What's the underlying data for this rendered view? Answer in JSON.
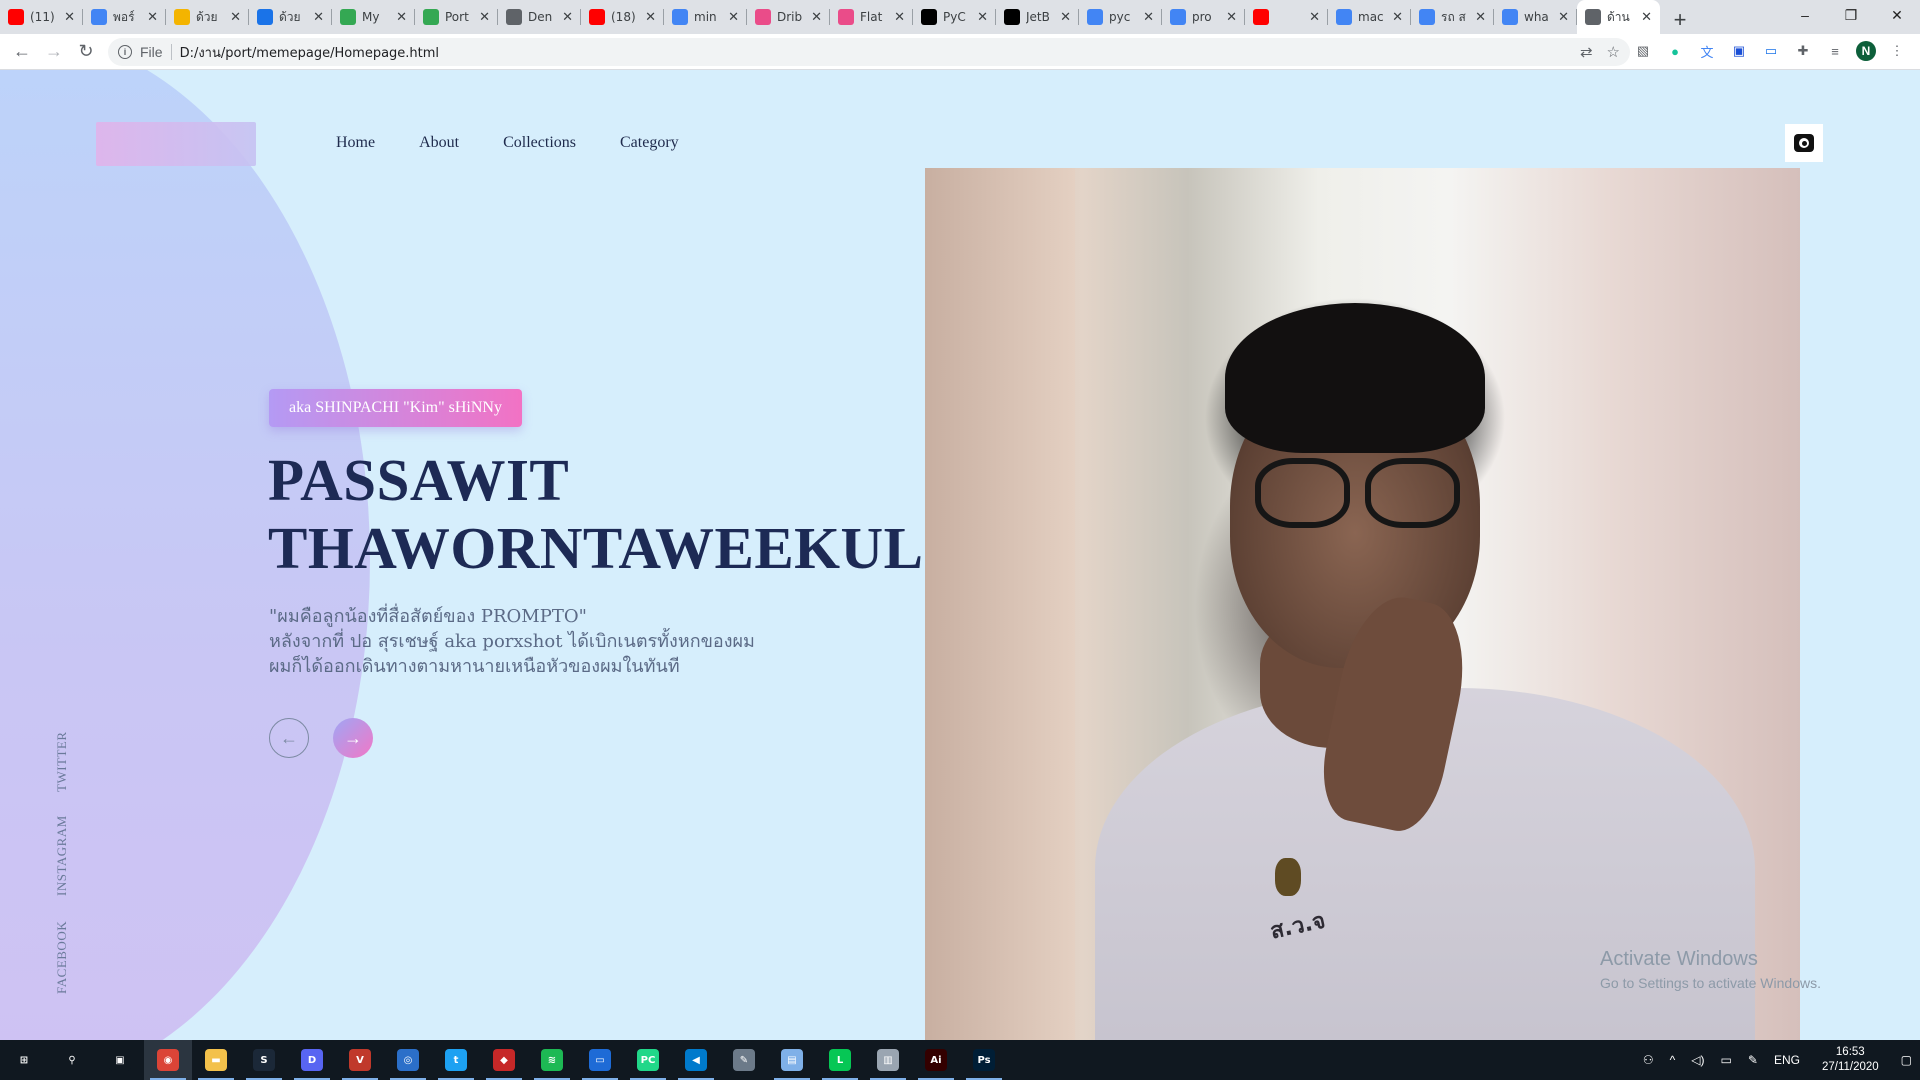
{
  "browser": {
    "tabs": [
      {
        "label": "(11)",
        "icon": "youtube-icon",
        "color": "#ff0000"
      },
      {
        "label": "พอร์",
        "icon": "google-icon",
        "color": "#4285f4"
      },
      {
        "label": "ด้วย",
        "icon": "slides-icon",
        "color": "#f4b400"
      },
      {
        "label": "ด้วย",
        "icon": "meet-icon",
        "color": "#1a73e8"
      },
      {
        "label": "My",
        "icon": "drive-icon",
        "color": "#34a853"
      },
      {
        "label": "Port",
        "icon": "drive-icon",
        "color": "#34a853"
      },
      {
        "label": "Den",
        "icon": "globe-icon",
        "color": "#5f6368"
      },
      {
        "label": "(18)",
        "icon": "youtube-icon",
        "color": "#ff0000"
      },
      {
        "label": "min",
        "icon": "google-icon",
        "color": "#4285f4"
      },
      {
        "label": "Drib",
        "icon": "dribbble-icon",
        "color": "#ea4c89"
      },
      {
        "label": "Flat",
        "icon": "dribbble-icon",
        "color": "#ea4c89"
      },
      {
        "label": "PyC",
        "icon": "jetbrains-icon",
        "color": "#000000"
      },
      {
        "label": "JetB",
        "icon": "jetbrains-icon",
        "color": "#000000"
      },
      {
        "label": "pyc",
        "icon": "google-icon",
        "color": "#4285f4"
      },
      {
        "label": "pro",
        "icon": "google-icon",
        "color": "#4285f4"
      },
      {
        "label": "",
        "icon": "youtube-icon",
        "color": "#ff0000"
      },
      {
        "label": "mac",
        "icon": "google-icon",
        "color": "#4285f4"
      },
      {
        "label": "รถ ส",
        "icon": "google-icon",
        "color": "#4285f4"
      },
      {
        "label": "wha",
        "icon": "google-icon",
        "color": "#4285f4"
      },
      {
        "label": "ด้าน",
        "icon": "globe-icon",
        "color": "#5f6368"
      }
    ],
    "address": {
      "scheme": "File",
      "url": "D:/งาน/port/memepage/Homepage.html"
    },
    "profile_initial": "N"
  },
  "site": {
    "nav": [
      "Home",
      "About",
      "Collections",
      "Category"
    ],
    "badge": "aka SHINPACHI \"Kim\" sHiNNy",
    "headline_line1": "PASSAWIT",
    "headline_line2": "THAWORNTAWEEKUL",
    "desc_line1": "\"ผมคือลูกน้องที่สื่อสัตย์ของ PROMPTO\"",
    "desc_line2": "หลังจากที่ ปอ สุรเชษฐ์ aka porxshot ได้เบิกเนตรทั้งหกของผม",
    "desc_line3": "ผมก็ได้ออกเดินทางตามหานายเหนือหัวของผมในทันที",
    "prev_arrow": "←",
    "next_arrow": "→",
    "social": [
      "TWITTER",
      "INSTAGRAM",
      "FACEBOOK"
    ],
    "photo_patch_text": "ส.ว.จ",
    "colors": {
      "background": "#d6eefc",
      "headline": "#1d2a55",
      "badge_gradient_start": "#b49af4",
      "badge_gradient_end": "#f272c4"
    }
  },
  "watermark": {
    "title": "Activate Windows",
    "subtitle": "Go to Settings to activate Windows."
  },
  "taskbar": {
    "apps": [
      {
        "name": "start-icon",
        "glyph": "⊞",
        "color": "#101820"
      },
      {
        "name": "search-icon",
        "glyph": "⚲",
        "color": "#101820"
      },
      {
        "name": "task-view-icon",
        "glyph": "▣",
        "color": "#101820"
      },
      {
        "name": "chrome-icon",
        "glyph": "◉",
        "color": "#db4437"
      },
      {
        "name": "file-explorer-icon",
        "glyph": "▬",
        "color": "#f3c14b"
      },
      {
        "name": "steam-icon",
        "glyph": "S",
        "color": "#1b2838"
      },
      {
        "name": "discord-icon",
        "glyph": "D",
        "color": "#5865f2"
      },
      {
        "name": "voicemeeter-icon",
        "glyph": "V",
        "color": "#c0392b"
      },
      {
        "name": "instagram-icon",
        "glyph": "◎",
        "color": "#2b6fc9"
      },
      {
        "name": "twitter-icon",
        "glyph": "t",
        "color": "#1da1f2"
      },
      {
        "name": "game-icon",
        "glyph": "◆",
        "color": "#c62828"
      },
      {
        "name": "spotify-icon",
        "glyph": "≋",
        "color": "#1db954"
      },
      {
        "name": "app-icon",
        "glyph": "▭",
        "color": "#1e6bd6"
      },
      {
        "name": "pycharm-icon",
        "glyph": "PC",
        "color": "#21d789"
      },
      {
        "name": "vscode-icon",
        "glyph": "◀",
        "color": "#007acc"
      },
      {
        "name": "app2-icon",
        "glyph": "✎",
        "color": "#6c7a89"
      },
      {
        "name": "notes-icon",
        "glyph": "▤",
        "color": "#7fb0e8"
      },
      {
        "name": "line-icon",
        "glyph": "L",
        "color": "#06c755"
      },
      {
        "name": "app3-icon",
        "glyph": "▥",
        "color": "#9aa5b1"
      },
      {
        "name": "illustrator-icon",
        "glyph": "Ai",
        "color": "#330000"
      },
      {
        "name": "photoshop-icon",
        "glyph": "Ps",
        "color": "#001e36"
      }
    ],
    "language": "ENG",
    "time": "16:53",
    "date": "27/11/2020"
  }
}
